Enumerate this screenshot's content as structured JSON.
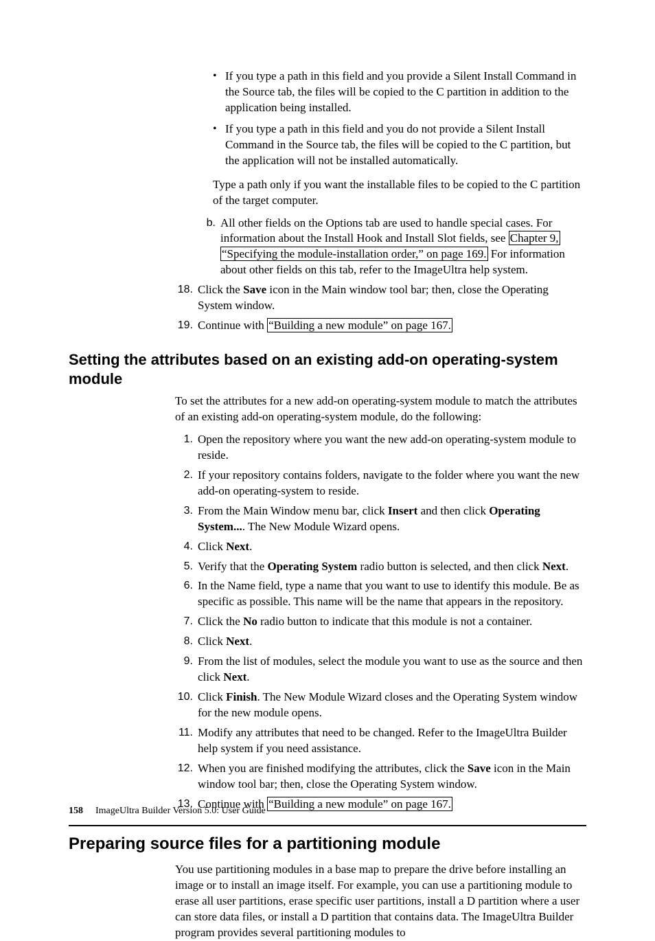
{
  "top_bullets": [
    "If you type a path in this field and you provide a Silent Install Command in the Source tab, the files will be copied to the C partition in addition to the application being installed.",
    "If you type a path in this field and you do not provide a Silent Install Command in the Source tab, the files will be copied to the C partition, but the application will not be installed automatically."
  ],
  "top_para": "Type a path only if you want the installable files to be copied to the C partition of the target computer.",
  "sub_b": {
    "num": "b.",
    "t1": "All other fields on the Options tab are used to handle special cases. For information about the Install Hook and Install Slot fields, see ",
    "link1a": "Chapter 9,",
    "link1b": "“Specifying the module-installation order,” on page 169.",
    "t2": " For information about other fields on this tab, refer to the ImageUltra help system."
  },
  "s18": {
    "num": "18.",
    "t1": "Click the ",
    "b1": "Save",
    "t2": " icon in the Main window tool bar; then, close the Operating System window."
  },
  "s19": {
    "num": "19.",
    "t1": "Continue with ",
    "link": "“Building a new module” on page 167."
  },
  "section1_title": "Setting the attributes based on an existing add-on operating-system module",
  "section1_intro": "To set the attributes for a new add-on operating-system module to match the attributes of an existing add-on operating-system module, do the following:",
  "p1": {
    "num": "1.",
    "text": "Open the repository where you want the new add-on operating-system module to reside."
  },
  "p2": {
    "num": "2.",
    "text": "If your repository contains folders, navigate to the folder where you want the new add-on operating-system to reside."
  },
  "p3": {
    "num": "3.",
    "t1": "From the Main Window menu bar, click ",
    "b1": "Insert",
    "t2": " and then click ",
    "b2": "Operating System...",
    "t3": ". The New Module Wizard opens."
  },
  "p4": {
    "num": "4.",
    "t1": "Click ",
    "b1": "Next",
    "t2": "."
  },
  "p5": {
    "num": "5.",
    "t1": "Verify that the ",
    "b1": "Operating System",
    "t2": " radio button is selected, and then click ",
    "b2": "Next",
    "t3": "."
  },
  "p6": {
    "num": "6.",
    "text": "In the Name field, type a name that you want to use to identify this module. Be as specific as possible. This name will be the name that appears in the repository."
  },
  "p7": {
    "num": "7.",
    "t1": "Click the ",
    "b1": "No",
    "t2": " radio button to indicate that this module is not a container."
  },
  "p8": {
    "num": "8.",
    "t1": "Click ",
    "b1": "Next",
    "t2": "."
  },
  "p9": {
    "num": "9.",
    "t1": "From the list of modules, select the module you want to use as the source and then click ",
    "b1": "Next",
    "t2": "."
  },
  "p10": {
    "num": "10.",
    "t1": "Click ",
    "b1": "Finish",
    "t2": ". The New Module Wizard closes and the Operating System window for the new module opens."
  },
  "p11": {
    "num": "11.",
    "text": "Modify any attributes that need to be changed. Refer to the ImageUltra Builder help system if you need assistance."
  },
  "p12": {
    "num": "12.",
    "t1": "When you are finished modifying the attributes, click the ",
    "b1": "Save",
    "t2": " icon in the Main window tool bar; then, close the Operating System window."
  },
  "p13": {
    "num": "13.",
    "t1": "Continue with ",
    "link": "“Building a new module” on page 167."
  },
  "head2": "Preparing source files for a partitioning module",
  "head2_para": "You use partitioning modules in a base map to prepare the drive before installing an image or to install an image itself. For example, you can use a partitioning module to erase all user partitions, erase specific user partitions, install a D partition where a user can store data files, or install a D partition that contains data. The ImageUltra Builder program provides several partitioning modules to",
  "footer": {
    "page": "158",
    "text": "ImageUltra Builder Version 5.0:  User Guide"
  }
}
